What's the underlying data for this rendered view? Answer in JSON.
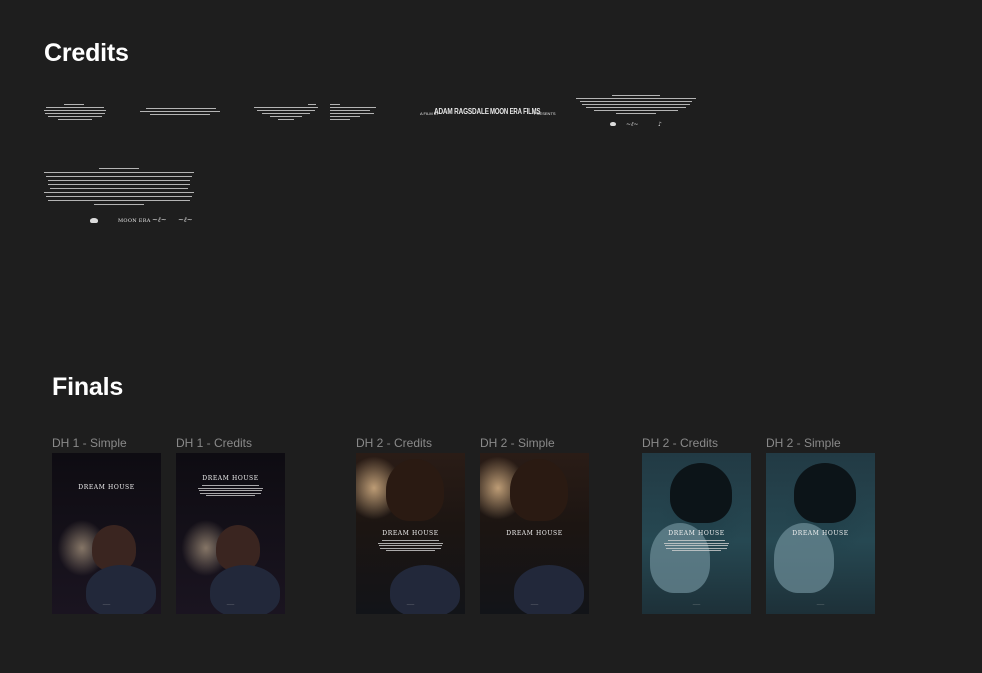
{
  "sections": {
    "credits": "Credits",
    "finals": "Finals"
  },
  "credits_frames": {
    "film_by_prefix": "A FILM BY",
    "director": "ADAM RAGSDALE",
    "studio": "MOON ERA FILMS",
    "presents": "PRESENTS",
    "logo_moon_era": "MOON ERA"
  },
  "finals": [
    {
      "label": "DH 1 - Simple",
      "poster_title": "DREAM HOUSE",
      "style": "dh1",
      "credits": false
    },
    {
      "label": "DH 1 - Credits",
      "poster_title": "DREAM HOUSE",
      "style": "dh1",
      "credits": true
    },
    {
      "label": "DH 2 - Credits",
      "poster_title": "DREAM HOUSE",
      "style": "dh2",
      "credits": true
    },
    {
      "label": "DH 2 - Simple",
      "poster_title": "DREAM HOUSE",
      "style": "dh2",
      "credits": false
    },
    {
      "label": "DH 2 - Credits",
      "poster_title": "DREAM HOUSE",
      "style": "dh2c",
      "credits": true
    },
    {
      "label": "DH 2 - Simple",
      "poster_title": "DREAM HOUSE",
      "style": "dh2c",
      "credits": false
    }
  ],
  "colors": {
    "background": "#1e1e1e",
    "label": "#8a8a8a",
    "title": "#ffffff"
  }
}
